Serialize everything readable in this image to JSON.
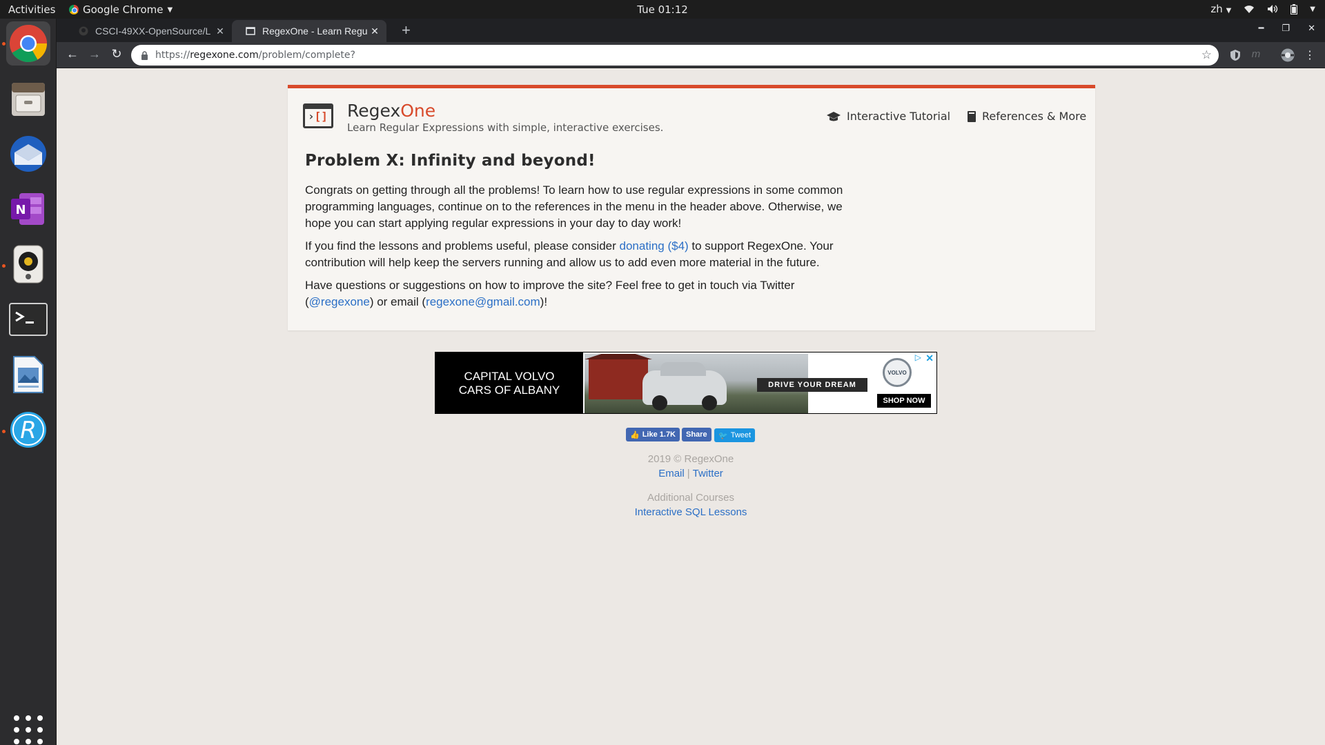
{
  "topbar": {
    "activities": "Activities",
    "app_name": "Google Chrome",
    "clock": "Tue 01:12",
    "lang": "zh"
  },
  "dock": {
    "items": [
      "chrome",
      "files",
      "thunderbird",
      "onenote",
      "rhythmbox",
      "terminal",
      "libreoffice-draw",
      "rstudio"
    ]
  },
  "tabs": [
    {
      "title": "CSCI-49XX-OpenSource/L",
      "active": false
    },
    {
      "title": "RegexOne - Learn Regular",
      "active": true
    }
  ],
  "address": {
    "scheme": "https://",
    "host": "regexone.com",
    "path": "/problem/complete?"
  },
  "site": {
    "brand_main": "Regex",
    "brand_accent": "One",
    "tagline": "Learn Regular Expressions with simple, interactive exercises.",
    "nav_tutorial": "Interactive Tutorial",
    "nav_references": "References & More",
    "accent_color": "#d84a2b",
    "link_color": "#2b6fc6"
  },
  "content": {
    "title": "Problem X: Infinity and beyond!",
    "p1": "Congrats on getting through all the problems! To learn how to use regular expressions in some common programming languages, continue on to the references in the menu in the header above. Otherwise, we hope you can start applying regular expressions in your day to day work!",
    "p2_before": "If you find the lessons and problems useful, please consider ",
    "p2_link": "donating ($4)",
    "p2_after": " to support RegexOne. Your contribution will help keep the servers running and allow us to add even more material in the future.",
    "p3_before": "Have questions or suggestions on how to improve the site? Feel free to get in touch via Twitter (",
    "p3_twitter": "@regexone",
    "p3_mid": ") or email (",
    "p3_email": "regexone@gmail.com",
    "p3_after": ")!"
  },
  "ad": {
    "line1": "CAPITAL VOLVO",
    "line2": "CARS OF ALBANY",
    "slogan": "DRIVE YOUR DREAM",
    "badge": "VOLVO",
    "cta": "SHOP NOW"
  },
  "social": {
    "like": "Like 1.7K",
    "share": "Share",
    "tweet": "Tweet"
  },
  "footer": {
    "copyright": "2019 © RegexOne",
    "email": "Email",
    "sep": "|",
    "twitter": "Twitter",
    "additional": "Additional Courses",
    "sql": "Interactive SQL Lessons"
  }
}
